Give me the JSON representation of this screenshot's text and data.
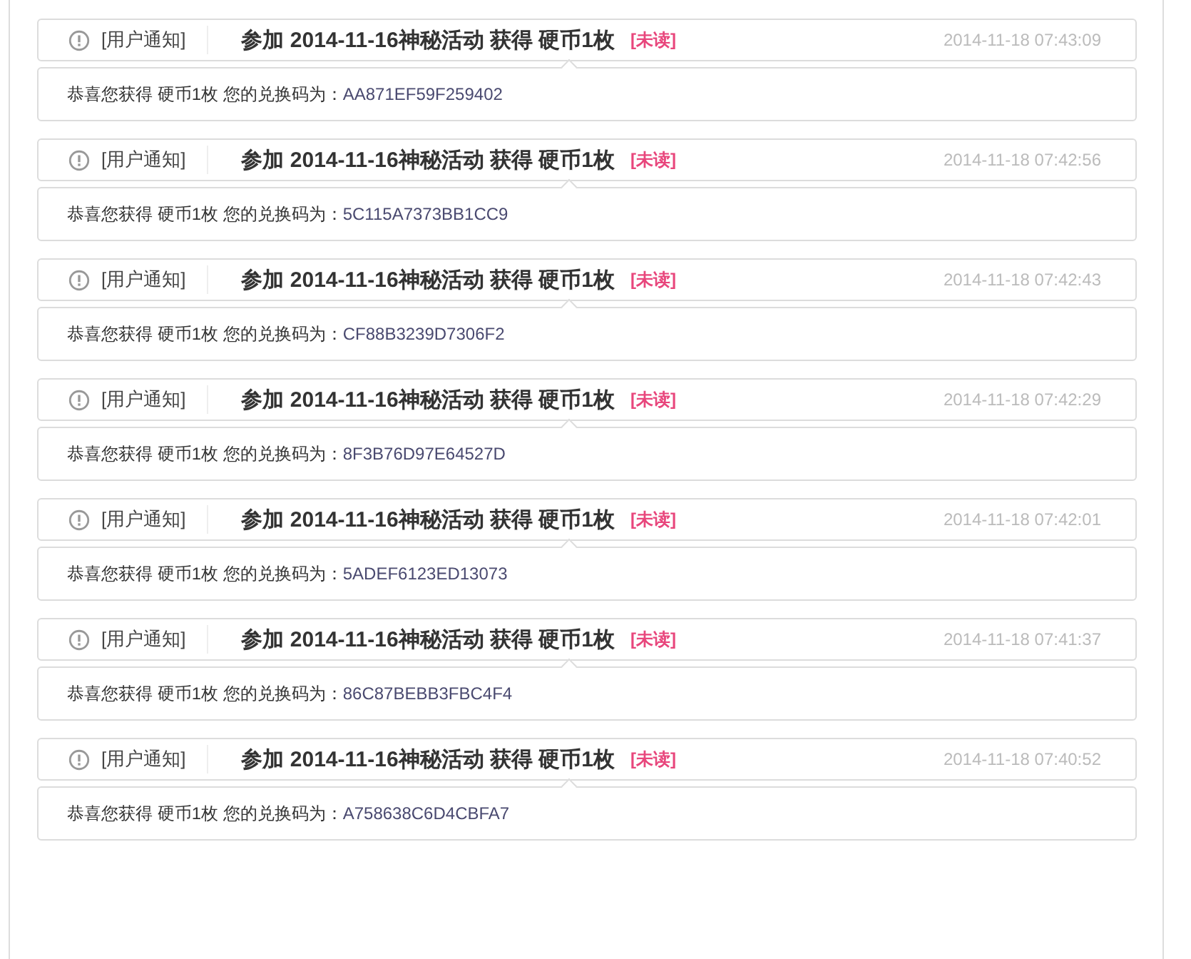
{
  "notifications": [
    {
      "category": "[用户通知]",
      "title": "参加 2014-11-16神秘活动 获得 硬币1枚",
      "unread": true,
      "status": "[未读]",
      "time": "2014-11-18 07:43:09",
      "message": "恭喜您获得 硬币1枚 您的兑换码为：",
      "code": "AA871EF59F259402"
    },
    {
      "category": "[用户通知]",
      "title": "参加 2014-11-16神秘活动 获得 硬币1枚",
      "unread": true,
      "status": "[未读]",
      "time": "2014-11-18 07:42:56",
      "message": "恭喜您获得 硬币1枚 您的兑换码为：",
      "code": "5C115A7373BB1CC9"
    },
    {
      "category": "[用户通知]",
      "title": "参加 2014-11-16神秘活动 获得 硬币1枚",
      "unread": true,
      "status": "[未读]",
      "time": "2014-11-18 07:42:43",
      "message": "恭喜您获得 硬币1枚 您的兑换码为：",
      "code": "CF88B3239D7306F2"
    },
    {
      "category": "[用户通知]",
      "title": "参加 2014-11-16神秘活动 获得 硬币1枚",
      "unread": true,
      "status": "[未读]",
      "time": "2014-11-18 07:42:29",
      "message": "恭喜您获得 硬币1枚 您的兑换码为：",
      "code": "8F3B76D97E64527D"
    },
    {
      "category": "[用户通知]",
      "title": "参加 2014-11-16神秘活动 获得 硬币1枚",
      "unread": true,
      "status": "[未读]",
      "time": "2014-11-18 07:42:01",
      "message": "恭喜您获得 硬币1枚 您的兑换码为：",
      "code": "5ADEF6123ED13073"
    },
    {
      "category": "[用户通知]",
      "title": "参加 2014-11-16神秘活动 获得 硬币1枚",
      "unread": true,
      "status": "[未读]",
      "time": "2014-11-18 07:41:37",
      "message": "恭喜您获得 硬币1枚 您的兑换码为：",
      "code": "86C87BEBB3FBC4F4"
    },
    {
      "category": "[用户通知]",
      "title": "参加 2014-11-16神秘活动 获得 硬币1枚",
      "unread": true,
      "status": "[未读]",
      "time": "2014-11-18 07:40:52",
      "message": "恭喜您获得 硬币1枚 您的兑换码为：",
      "code": "A758638C6D4CBFA7"
    }
  ]
}
